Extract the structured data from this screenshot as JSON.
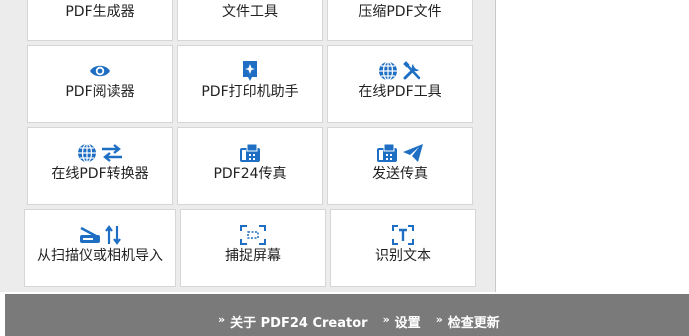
{
  "tiles_row0": [
    {
      "label": "PDF生成器"
    },
    {
      "label": "文件工具"
    },
    {
      "label": "压缩PDF文件"
    }
  ],
  "tiles_row1": [
    {
      "label": "PDF阅读器",
      "icons": [
        "eye-icon"
      ]
    },
    {
      "label": "PDF打印机助手",
      "icons": [
        "print-helper-icon"
      ]
    },
    {
      "label": "在线PDF工具",
      "icons": [
        "globe-icon",
        "tools-icon"
      ]
    }
  ],
  "tiles_row2": [
    {
      "label": "在线PDF转换器",
      "icons": [
        "globe-icon",
        "convert-arrows-icon"
      ]
    },
    {
      "label": "PDF24传真",
      "icons": [
        "fax-icon"
      ]
    },
    {
      "label": "发送传真",
      "icons": [
        "fax-icon",
        "send-plane-icon"
      ]
    }
  ],
  "tiles_row3": [
    {
      "label": "从扫描仪或相机导入",
      "icons": [
        "scanner-icon",
        "transfer-arrows-icon"
      ]
    },
    {
      "label": "捕捉屏幕",
      "icons": [
        "screen-capture-icon"
      ]
    },
    {
      "label": "识别文本",
      "icons": [
        "ocr-text-icon"
      ]
    }
  ],
  "footer": {
    "links": [
      {
        "arrow": "»",
        "label": "关于 PDF24 Creator"
      },
      {
        "arrow": "»",
        "label": "设置"
      },
      {
        "arrow": "»",
        "label": "检查更新"
      }
    ]
  },
  "colors": {
    "icon_blue": "#1e6fc4",
    "footer_bg": "#7a7a7a",
    "panel_bg": "#ececec"
  }
}
